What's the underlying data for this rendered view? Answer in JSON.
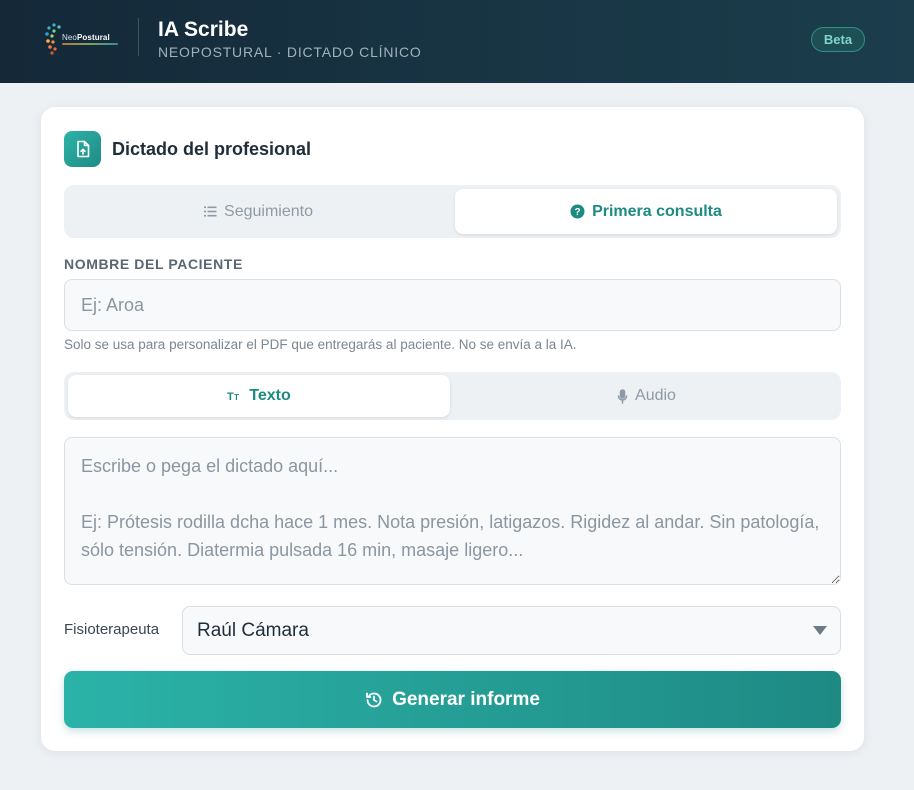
{
  "header": {
    "logo_text_prefix": "Neo",
    "logo_text_suffix": "Postural",
    "title": "IA Scribe",
    "subtitle": "NEOPOSTURAL · DICTADO CLÍNICO",
    "badge": "Beta"
  },
  "card": {
    "title": "Dictado del profesional",
    "consult_tabs": [
      {
        "label": "Seguimiento",
        "icon": "list-icon",
        "active": false
      },
      {
        "label": "Primera consulta",
        "icon": "question-circle-icon",
        "active": true
      }
    ],
    "patient": {
      "label": "NOMBRE DEL PACIENTE",
      "placeholder": "Ej: Aroa",
      "value": "",
      "hint": "Solo se usa para personalizar el PDF que entregarás al paciente. No se envía a la IA."
    },
    "input_tabs": [
      {
        "label": "Texto",
        "icon": "text-size-icon",
        "active": true
      },
      {
        "label": "Audio",
        "icon": "microphone-icon",
        "active": false
      }
    ],
    "dictation": {
      "placeholder": "Escribe o pega el dictado aquí...\n\nEj: Prótesis rodilla dcha hace 1 mes. Nota presión, latigazos. Rigidez al andar. Sin patología, sólo tensión. Diatermia pulsada 16 min, masaje ligero...",
      "value": ""
    },
    "physio": {
      "label": "Fisioterapeuta",
      "selected": "Raúl Cámara"
    },
    "generate_button": {
      "label": "Generar informe",
      "icon": "history-icon"
    }
  },
  "colors": {
    "header_bg": "#152a3a",
    "accent": "#1e8a84",
    "accent_light": "#2bb3a8",
    "page_bg": "#eef1f4"
  }
}
